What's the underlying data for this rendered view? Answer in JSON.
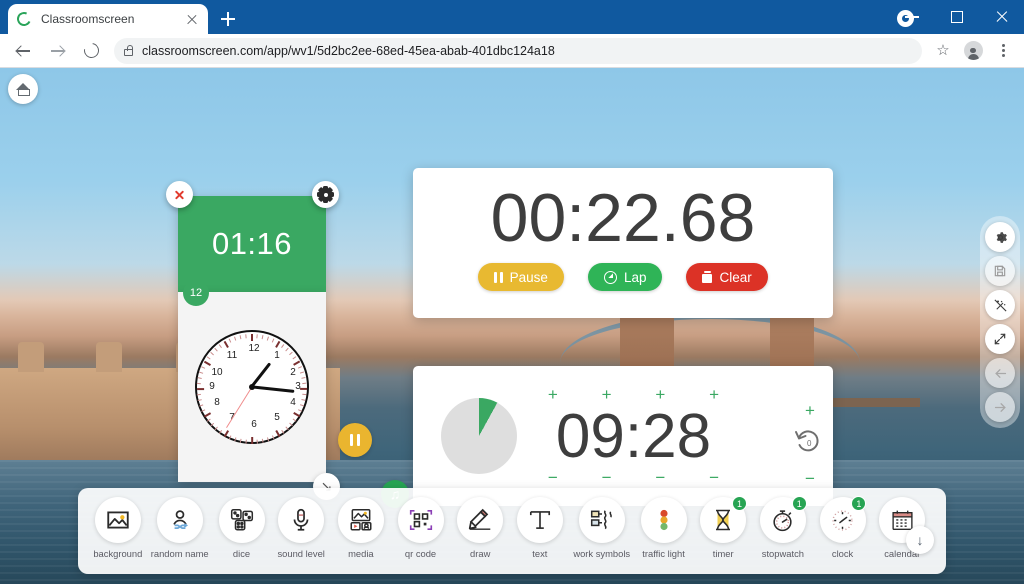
{
  "browser": {
    "tab": {
      "title": "Classroomscreen",
      "favicon": "classroomscreen-logo-icon",
      "close": "×"
    },
    "newtab_label": "+",
    "url": "classroomscreen.com/app/wv1/5d2bc2ee-68ed-45ea-abab-401dbc124a18",
    "omnibox_icons": [
      "lock-icon",
      "bookmark-star-icon",
      "profile-avatar-icon",
      "kebab-menu-icon"
    ],
    "nav": {
      "back": "back-arrow-icon",
      "forward": "forward-arrow-icon",
      "reload": "reload-icon"
    },
    "window": {
      "minimize": "minimize-icon",
      "maximize": "maximize-icon",
      "close": "close-icon"
    }
  },
  "app": {
    "home_button": "home-icon",
    "background_scene": "tower-bridge-london-photo"
  },
  "green_timer": {
    "time": "01:16",
    "badge": "12",
    "close_label": "close-widget",
    "settings_label": "widget-settings"
  },
  "analog_clock": {
    "numbers": [
      "12",
      "1",
      "2",
      "3",
      "4",
      "5",
      "6",
      "7",
      "8",
      "9",
      "10",
      "11"
    ],
    "hour_angle": 38,
    "minute_angle": 96,
    "second_angle": 212,
    "resize_glyph": "↘"
  },
  "stopwatch": {
    "time": "00:22.68",
    "buttons": [
      {
        "label": "Pause",
        "icon": "pause-icon",
        "color": "#e8b931"
      },
      {
        "label": "Lap",
        "icon": "stopwatch-icon",
        "color": "#2fb457"
      },
      {
        "label": "Clear",
        "icon": "trash-icon",
        "color": "#dc3226"
      }
    ]
  },
  "timer": {
    "time": "09:28",
    "progress_percent": 8,
    "plus_label": "+",
    "minus_label": "−",
    "plus_count": 4,
    "pause_icon": "pause-icon",
    "reset_icon": "reset-to-zero-icon",
    "music_icon": "music-note-icon",
    "accent_green": "#3aa862",
    "accent_yellow": "#eab52f"
  },
  "side_toolbar": [
    {
      "name": "settings",
      "icon": "gear-icon",
      "enabled": true
    },
    {
      "name": "save",
      "icon": "save-disk-icon",
      "enabled": false
    },
    {
      "name": "clear-all",
      "icon": "wand-off-icon",
      "enabled": true
    },
    {
      "name": "fullscreen",
      "icon": "expand-icon",
      "enabled": true
    },
    {
      "name": "undo",
      "icon": "arrow-left-icon",
      "enabled": false
    },
    {
      "name": "redo",
      "icon": "arrow-right-icon",
      "enabled": false
    }
  ],
  "bottom_toolbar": {
    "collapse_icon": "chevron-down-icon",
    "tools": [
      {
        "label": "background",
        "icon": "image-icon",
        "badge": null
      },
      {
        "label": "random name",
        "icon": "person-shuffle-icon",
        "badge": null
      },
      {
        "label": "dice",
        "icon": "dice-icon",
        "badge": null
      },
      {
        "label": "sound level",
        "icon": "microphone-icon",
        "badge": null
      },
      {
        "label": "media",
        "icon": "media-icon",
        "badge": null
      },
      {
        "label": "qr code",
        "icon": "qr-code-icon",
        "badge": null
      },
      {
        "label": "draw",
        "icon": "pencil-icon",
        "badge": null
      },
      {
        "label": "text",
        "icon": "text-t-icon",
        "badge": null
      },
      {
        "label": "work symbols",
        "icon": "work-symbols-icon",
        "badge": null
      },
      {
        "label": "traffic light",
        "icon": "traffic-light-icon",
        "badge": null
      },
      {
        "label": "timer",
        "icon": "hourglass-icon",
        "badge": "1"
      },
      {
        "label": "stopwatch",
        "icon": "stopwatch-icon",
        "badge": "1"
      },
      {
        "label": "clock",
        "icon": "analog-clock-icon",
        "badge": "1"
      },
      {
        "label": "calendar",
        "icon": "calendar-icon",
        "badge": null
      }
    ]
  }
}
